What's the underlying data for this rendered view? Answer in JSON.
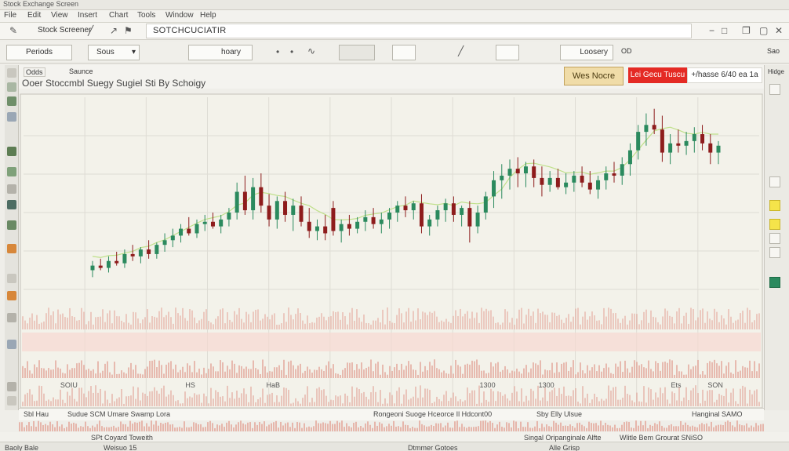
{
  "window": {
    "title": "Stock Exchange Screen"
  },
  "menu": [
    {
      "label": "File"
    },
    {
      "label": "Edit"
    },
    {
      "label": "View"
    },
    {
      "label": "Insert"
    },
    {
      "label": "Chart"
    },
    {
      "label": "Tools"
    },
    {
      "label": "Window"
    },
    {
      "label": "Help"
    }
  ],
  "toolbar": {
    "field_label": "Stock Screener",
    "app_title": "SOTCHCUCIATIR",
    "periods_button": "Periods",
    "select_value": "Sous",
    "input_value": "hoary",
    "right_label": "Loosery",
    "right_small": "OD",
    "far_right": "Sao"
  },
  "info": {
    "tab1": "Odds",
    "tab2": "Saunce",
    "chart_caption": "Ooer Stoccmbl Suegy Sugiel Sti By Schoigy",
    "notes_button": "Wes Nocre",
    "red_button": "Lei Gecu Tuscu",
    "quote": "+/hasse 6/40 ea 1a"
  },
  "right_panel": {
    "header": "Hidge"
  },
  "bottom": {
    "row1": [
      "Sbl Hau",
      "Sudue SCM Umare Swamp Lora",
      "Rongeoni Suoge Hceorce Il Hdcont00",
      "Sby Elly Ulsue",
      "Hanginal SAMO"
    ],
    "row2": [
      "SPt Coyard Toweith",
      "Singal Oripanginale Alfte",
      "Wlitle Bem Grourat SNiSO"
    ],
    "status": [
      "Baoly  Bale",
      "Weisuo 15",
      "Dtmmer Gotoes",
      "Alle Grisp"
    ]
  },
  "chart_data": {
    "type": "candlestick",
    "y_axis": {
      "min": 0,
      "max": 100,
      "grid": true
    },
    "x_axis": {
      "grid": true
    },
    "candles": [
      {
        "o": 25,
        "h": 29,
        "l": 22,
        "c": 27
      },
      {
        "o": 27,
        "h": 30,
        "l": 25,
        "c": 26
      },
      {
        "o": 26,
        "h": 31,
        "l": 24,
        "c": 29
      },
      {
        "o": 29,
        "h": 33,
        "l": 27,
        "c": 28
      },
      {
        "o": 28,
        "h": 34,
        "l": 26,
        "c": 32
      },
      {
        "o": 32,
        "h": 36,
        "l": 29,
        "c": 31
      },
      {
        "o": 31,
        "h": 35,
        "l": 28,
        "c": 34
      },
      {
        "o": 34,
        "h": 38,
        "l": 30,
        "c": 32
      },
      {
        "o": 32,
        "h": 37,
        "l": 30,
        "c": 36
      },
      {
        "o": 36,
        "h": 41,
        "l": 33,
        "c": 38
      },
      {
        "o": 38,
        "h": 43,
        "l": 35,
        "c": 40
      },
      {
        "o": 40,
        "h": 45,
        "l": 37,
        "c": 43
      },
      {
        "o": 43,
        "h": 48,
        "l": 40,
        "c": 41
      },
      {
        "o": 41,
        "h": 47,
        "l": 39,
        "c": 45
      },
      {
        "o": 45,
        "h": 49,
        "l": 42,
        "c": 46
      },
      {
        "o": 46,
        "h": 50,
        "l": 43,
        "c": 44
      },
      {
        "o": 44,
        "h": 49,
        "l": 41,
        "c": 47
      },
      {
        "o": 47,
        "h": 52,
        "l": 44,
        "c": 50
      },
      {
        "o": 50,
        "h": 63,
        "l": 47,
        "c": 59
      },
      {
        "o": 59,
        "h": 66,
        "l": 49,
        "c": 51
      },
      {
        "o": 51,
        "h": 65,
        "l": 47,
        "c": 61
      },
      {
        "o": 61,
        "h": 67,
        "l": 50,
        "c": 53
      },
      {
        "o": 53,
        "h": 58,
        "l": 44,
        "c": 47
      },
      {
        "o": 47,
        "h": 57,
        "l": 43,
        "c": 55
      },
      {
        "o": 55,
        "h": 59,
        "l": 46,
        "c": 49
      },
      {
        "o": 49,
        "h": 56,
        "l": 42,
        "c": 53
      },
      {
        "o": 53,
        "h": 57,
        "l": 44,
        "c": 46
      },
      {
        "o": 46,
        "h": 52,
        "l": 39,
        "c": 42
      },
      {
        "o": 42,
        "h": 47,
        "l": 38,
        "c": 44
      },
      {
        "o": 44,
        "h": 49,
        "l": 38,
        "c": 41
      },
      {
        "o": 52,
        "h": 55,
        "l": 40,
        "c": 42
      },
      {
        "o": 42,
        "h": 47,
        "l": 37,
        "c": 45
      },
      {
        "o": 45,
        "h": 49,
        "l": 40,
        "c": 43
      },
      {
        "o": 43,
        "h": 48,
        "l": 41,
        "c": 46
      },
      {
        "o": 46,
        "h": 51,
        "l": 42,
        "c": 48
      },
      {
        "o": 48,
        "h": 52,
        "l": 43,
        "c": 45
      },
      {
        "o": 45,
        "h": 50,
        "l": 41,
        "c": 47
      },
      {
        "o": 47,
        "h": 52,
        "l": 43,
        "c": 50
      },
      {
        "o": 50,
        "h": 55,
        "l": 46,
        "c": 53
      },
      {
        "o": 53,
        "h": 57,
        "l": 48,
        "c": 51
      },
      {
        "o": 51,
        "h": 55,
        "l": 47,
        "c": 54
      },
      {
        "o": 54,
        "h": 58,
        "l": 41,
        "c": 44
      },
      {
        "o": 44,
        "h": 49,
        "l": 40,
        "c": 47
      },
      {
        "o": 47,
        "h": 53,
        "l": 44,
        "c": 51
      },
      {
        "o": 51,
        "h": 56,
        "l": 46,
        "c": 54
      },
      {
        "o": 54,
        "h": 57,
        "l": 46,
        "c": 49
      },
      {
        "o": 49,
        "h": 53,
        "l": 44,
        "c": 52
      },
      {
        "o": 52,
        "h": 55,
        "l": 37,
        "c": 44
      },
      {
        "o": 44,
        "h": 53,
        "l": 41,
        "c": 50
      },
      {
        "o": 50,
        "h": 59,
        "l": 47,
        "c": 57
      },
      {
        "o": 57,
        "h": 68,
        "l": 52,
        "c": 64
      },
      {
        "o": 64,
        "h": 71,
        "l": 56,
        "c": 66
      },
      {
        "o": 66,
        "h": 73,
        "l": 60,
        "c": 69
      },
      {
        "o": 69,
        "h": 74,
        "l": 61,
        "c": 67
      },
      {
        "o": 67,
        "h": 72,
        "l": 61,
        "c": 70
      },
      {
        "o": 70,
        "h": 73,
        "l": 61,
        "c": 65
      },
      {
        "o": 65,
        "h": 70,
        "l": 57,
        "c": 62
      },
      {
        "o": 62,
        "h": 68,
        "l": 59,
        "c": 65
      },
      {
        "o": 65,
        "h": 69,
        "l": 60,
        "c": 61
      },
      {
        "o": 61,
        "h": 67,
        "l": 58,
        "c": 63
      },
      {
        "o": 63,
        "h": 68,
        "l": 59,
        "c": 66
      },
      {
        "o": 66,
        "h": 70,
        "l": 61,
        "c": 63
      },
      {
        "o": 63,
        "h": 68,
        "l": 58,
        "c": 60
      },
      {
        "o": 60,
        "h": 66,
        "l": 56,
        "c": 64
      },
      {
        "o": 64,
        "h": 70,
        "l": 60,
        "c": 67
      },
      {
        "o": 67,
        "h": 72,
        "l": 63,
        "c": 66
      },
      {
        "o": 66,
        "h": 74,
        "l": 62,
        "c": 71
      },
      {
        "o": 71,
        "h": 80,
        "l": 66,
        "c": 77
      },
      {
        "o": 77,
        "h": 88,
        "l": 73,
        "c": 85
      },
      {
        "o": 85,
        "h": 93,
        "l": 79,
        "c": 88
      },
      {
        "o": 88,
        "h": 95,
        "l": 84,
        "c": 86
      },
      {
        "o": 86,
        "h": 92,
        "l": 72,
        "c": 76
      },
      {
        "o": 76,
        "h": 84,
        "l": 71,
        "c": 80
      },
      {
        "o": 80,
        "h": 86,
        "l": 76,
        "c": 79
      },
      {
        "o": 79,
        "h": 85,
        "l": 75,
        "c": 81
      },
      {
        "o": 81,
        "h": 87,
        "l": 76,
        "c": 84
      },
      {
        "o": 84,
        "h": 88,
        "l": 77,
        "c": 80
      },
      {
        "o": 80,
        "h": 84,
        "l": 71,
        "c": 76
      },
      {
        "o": 76,
        "h": 81,
        "l": 71,
        "c": 79
      }
    ],
    "annotations": [
      {
        "text": "SOIU",
        "x": 5,
        "y": 12
      },
      {
        "text": "HS",
        "x": 22,
        "y": 12
      },
      {
        "text": "HaB",
        "x": 33,
        "y": 12
      },
      {
        "text": "1300",
        "x": 62,
        "y": 12
      },
      {
        "text": "1300",
        "x": 70,
        "y": 12
      },
      {
        "text": "Ets",
        "x": 88,
        "y": 12
      },
      {
        "text": "SON",
        "x": 93,
        "y": 12
      }
    ],
    "colors": {
      "up": "#2b8a5e",
      "down": "#8e1c1c",
      "ma": "#bfe08a",
      "volume": "#e3a79b",
      "grid": "#dedcd4"
    }
  }
}
